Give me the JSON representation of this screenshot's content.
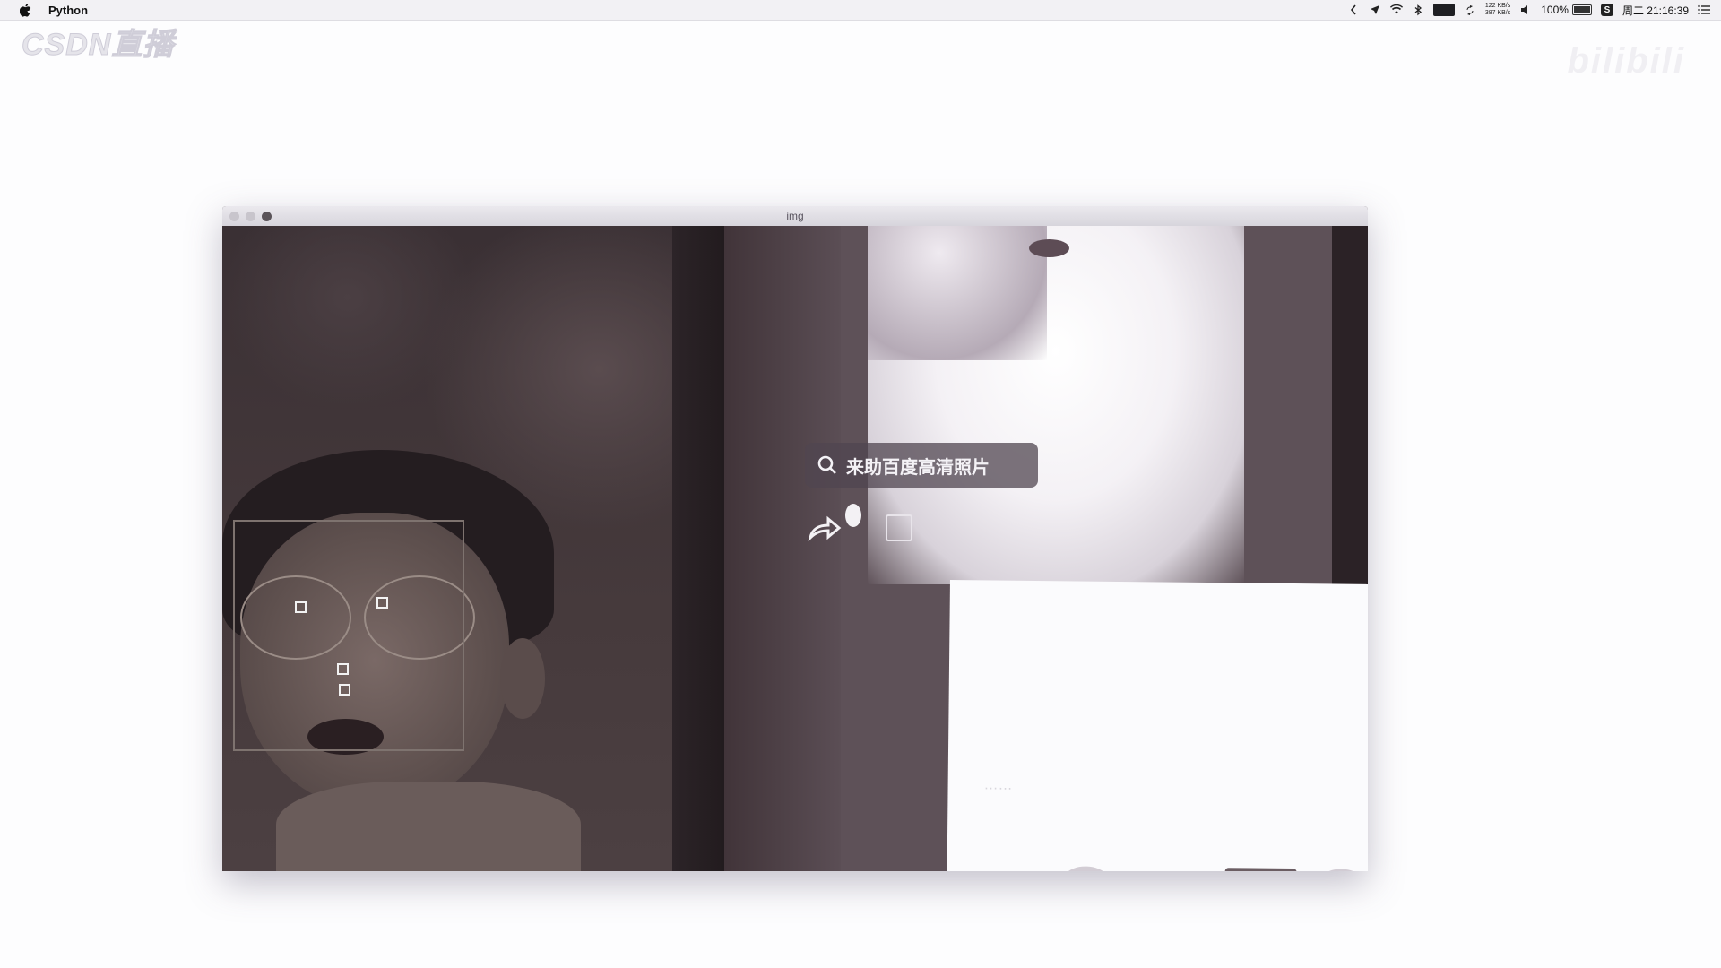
{
  "menubar": {
    "app_name": "Python",
    "net_up": "122 KB/s",
    "net_down": "387 KB/s",
    "battery_percent": "100%",
    "clock": "周二 21:16:39",
    "input_source": "S"
  },
  "watermarks": {
    "left": "CSDN直播",
    "right": "bilibili"
  },
  "window": {
    "title": "img"
  },
  "screen_content": {
    "search_text": "来助百度高清照片",
    "panel_text": "……"
  },
  "colors": {
    "menubar_bg": "#f2f1f4",
    "window_titlebar": "#e2e0e6",
    "face_box": "#7e736f",
    "landmark": "#f2f2f2"
  }
}
